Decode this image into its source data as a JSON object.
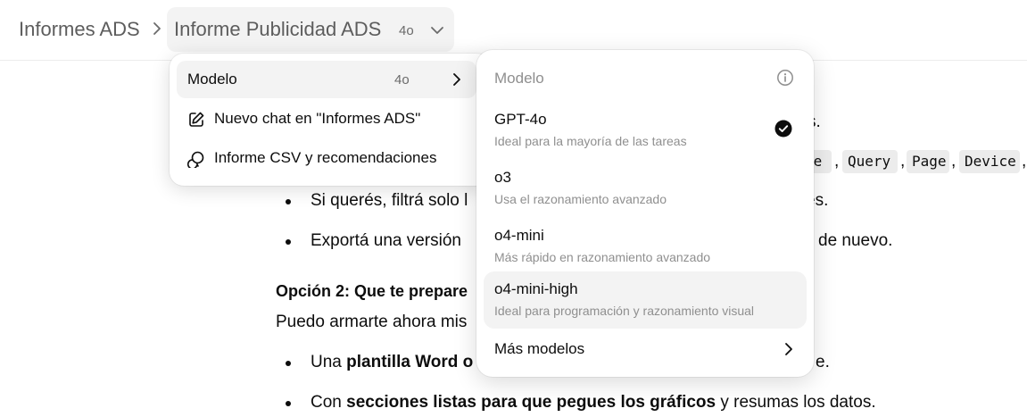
{
  "header": {
    "breadcrumb_root": "Informes ADS",
    "current_title": "Informe Publicidad ADS",
    "model_badge": "4o"
  },
  "document": {
    "code_tags": [
      "te",
      "Query",
      "Page",
      "Device"
    ],
    "bullet1_text": "Si querés, filtrá solo l",
    "bullet1_tail": "es.",
    "bullet2_text": "Exportá una versión ",
    "bullet2_tail": "de nuevo.",
    "option2_heading": "Opción 2: Que te prepare",
    "option2_intro": "Puedo armarte ahora mis",
    "bullet3_prefix": "Una ",
    "bullet3_bold": "plantilla Word o",
    "bullet3_tail": "e.",
    "bullet4_prefix": "Con ",
    "bullet4_bold": "secciones listas para que pegues los gráficos",
    "bullet4_tail": " y resumas los datos.",
    "partial_period": "s."
  },
  "menu": {
    "items": [
      {
        "label": "Modelo",
        "badge": "4o"
      },
      {
        "label": "Nuevo chat en \"Informes ADS\""
      },
      {
        "label": "Informe CSV y recomendaciones"
      }
    ]
  },
  "submenu": {
    "heading": "Modelo",
    "models": [
      {
        "name": "GPT-4o",
        "desc": "Ideal para la mayoría de las tareas",
        "selected": true
      },
      {
        "name": "o3",
        "desc": "Usa el razonamiento avanzado"
      },
      {
        "name": "o4-mini",
        "desc": "Más rápido en razonamiento avanzado"
      },
      {
        "name": "o4-mini-high",
        "desc": "Ideal para programación y razonamiento visual"
      }
    ],
    "more_label": "Más modelos"
  },
  "icons": {
    "chevron": "chevron-right-icon",
    "info": "info-icon",
    "edit": "edit-icon",
    "chat": "chat-bubble-icon",
    "check": "checkmark-circle-icon"
  }
}
